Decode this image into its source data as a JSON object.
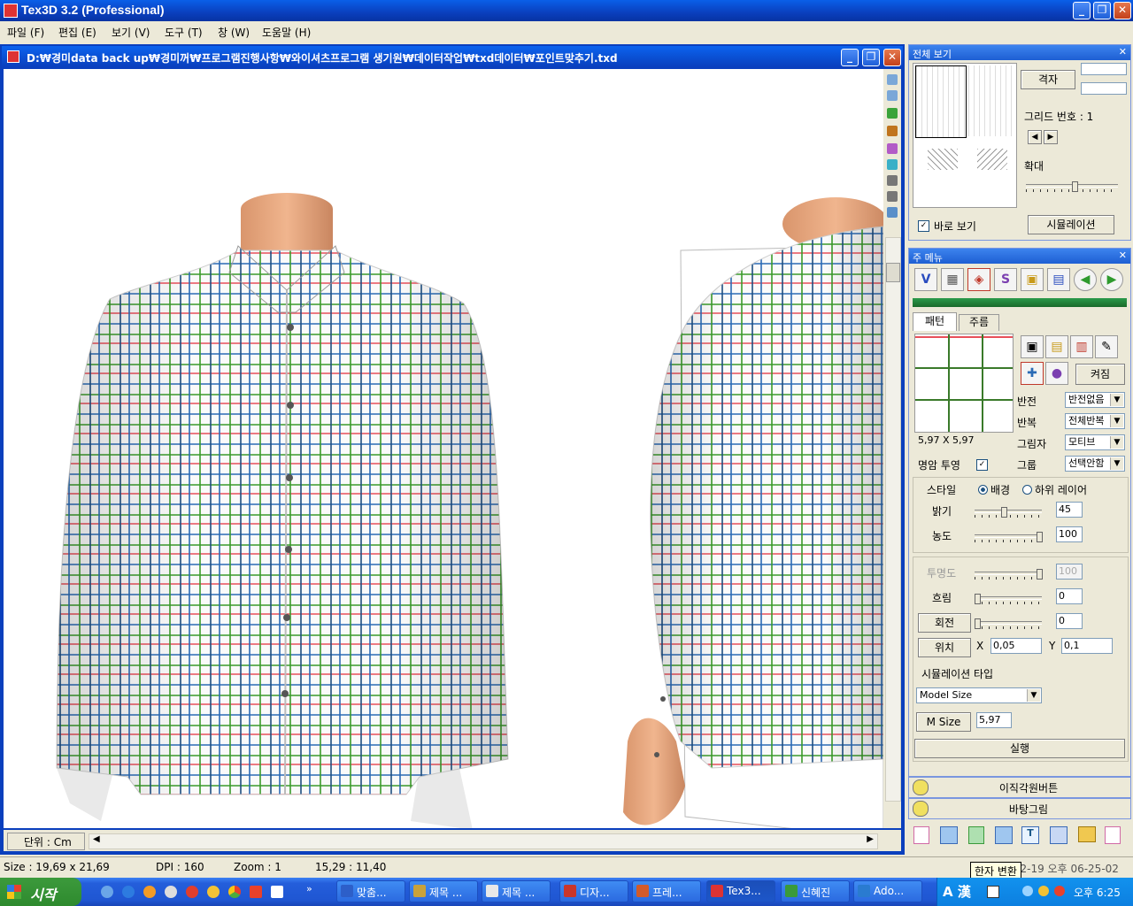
{
  "app": {
    "title": "Tex3D 3.2 (Professional)",
    "menu": [
      "파일 (F)",
      "편집 (E)",
      "보기 (V)",
      "도구 (T)",
      "창 (W)",
      "도움말 (H)"
    ]
  },
  "document": {
    "title": "D:₩경미data back up₩경미꺼₩프로그램진행사항₩와이셔츠프로그램 생기원₩데이터작업₩txd데이터₩포인트맞추기.txd",
    "unit_label": "단위 : Cm",
    "unit_arrow": "▼"
  },
  "overview": {
    "title": "전체 보기",
    "grid_button": "격자",
    "grid_number": "그리드 번호 : 1",
    "zoom_label": "확대",
    "live_view": "바로 보기",
    "simulation_button": "시뮬레이션"
  },
  "main_menu": {
    "title": "주 메뉴",
    "tools": [
      "V",
      "▦",
      "◈",
      "S",
      "▣",
      "▤",
      "◀",
      "▶"
    ],
    "tabs": [
      "패턴",
      "주름"
    ],
    "pattern_size": "5,97 X 5,97",
    "toggle_button": "켜짐",
    "flip_label": "반전",
    "flip_value": "반전없음",
    "repeat_label": "반복",
    "repeat_value": "전체반복",
    "shadow_label": "그림자",
    "shadow_value": "모티브",
    "group_label": "그룹",
    "group_value": "선택안함",
    "transparency_label": "명암 투영",
    "style_label": "스타일",
    "style_option_bg": "배경",
    "style_option_layer": "하위 레이어",
    "brightness_label": "밝기",
    "brightness_value": "45",
    "density_label": "농도",
    "density_value": "100",
    "opacity_label": "투명도",
    "opacity_value": "100",
    "blur_label": "흐림",
    "blur_value": "0",
    "rotate_button": "회전",
    "rotate_value": "0",
    "position_button": "위치",
    "x_label": "X",
    "x_value": "0,05",
    "y_label": "Y",
    "y_value": "0,1",
    "sim_type_label": "시뮬레이션 타입",
    "sim_type_value": "Model Size",
    "msize_button": "M Size",
    "msize_value": "5,97",
    "run_button": "실행"
  },
  "bottom_panels": [
    "이직각원버튼",
    "바탕그림"
  ],
  "status": {
    "size": "Size : 19,69 x 21,69",
    "dpi": "DPI : 160",
    "zoom": "Zoom : 1",
    "coords": "15,29 : 11,40",
    "datetime": "2012-02-19 오후 06-25-02",
    "tooltip": "한자 변환"
  },
  "taskbar": {
    "start": "시작",
    "tasks": [
      "맞춤...",
      "제목 ...",
      "제목 ...",
      "디자...",
      "프레...",
      "Tex3...",
      "신혜진",
      "Ado..."
    ],
    "clock": "오후 6:25",
    "ime": "A 漢"
  },
  "colors": {
    "xp_blue": "#0a3fbd",
    "panel_bg": "#ece9d8",
    "plaid_red": "#e8505a",
    "plaid_green": "#3a9a2a",
    "plaid_blue": "#2a6ab5"
  }
}
